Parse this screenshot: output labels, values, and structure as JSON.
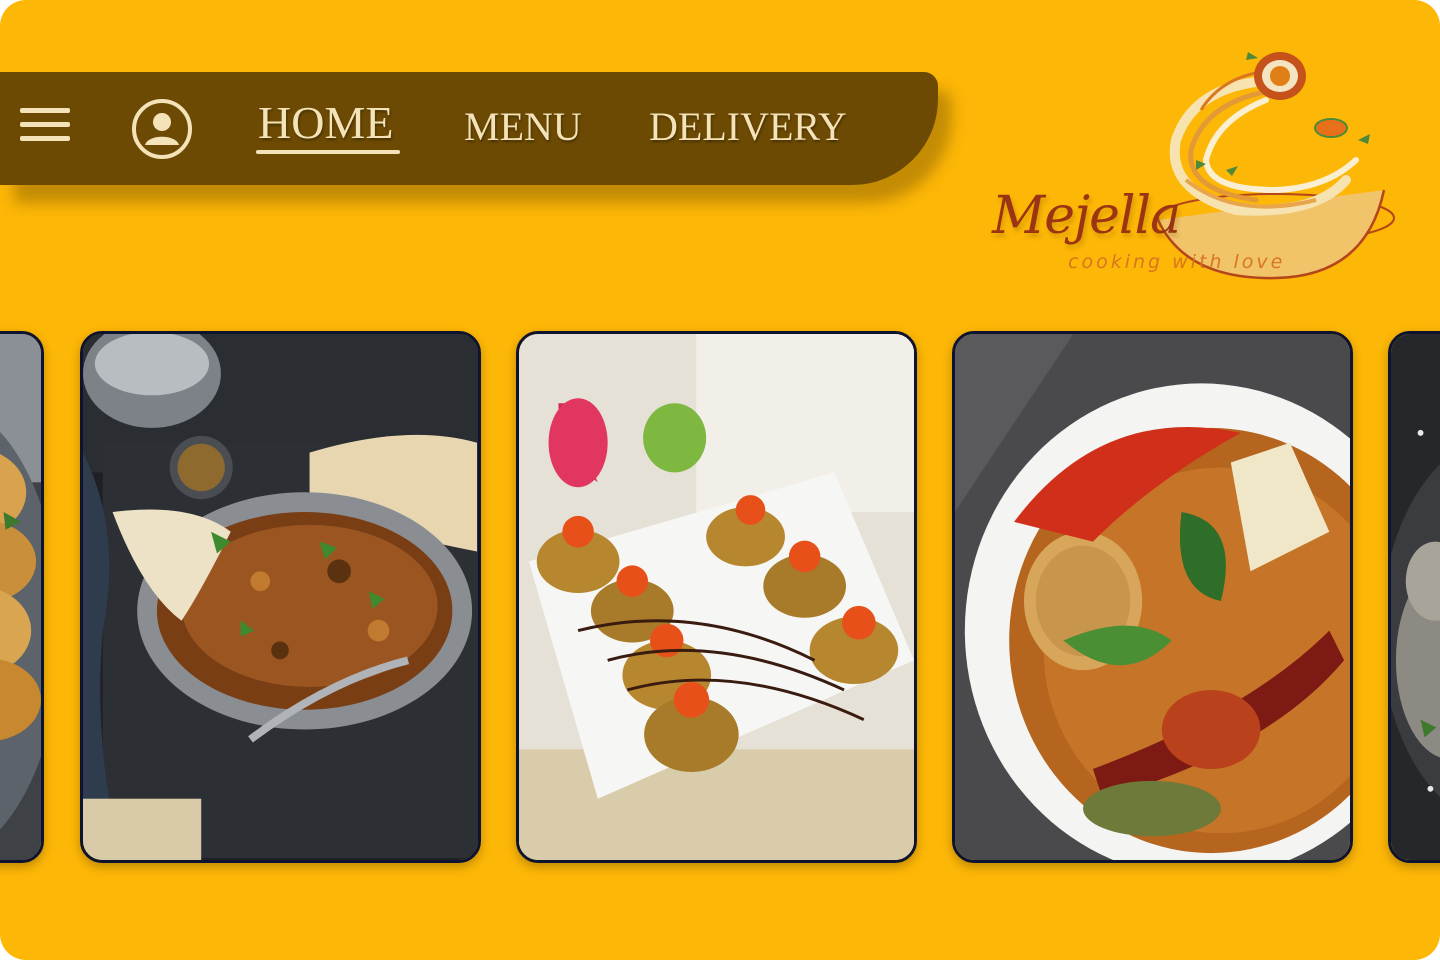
{
  "nav": {
    "menu_icon": "hamburger-menu-icon",
    "account_icon": "user-account-icon",
    "links": [
      {
        "label": "HOME",
        "active": true
      },
      {
        "label": "MENU",
        "active": false
      },
      {
        "label": "DELIVERY",
        "active": false
      }
    ]
  },
  "brand": {
    "name": "Mejella",
    "tagline": "cooking with love"
  },
  "gallery": {
    "items": [
      {
        "dish": "empanadas"
      },
      {
        "dish": "keema-curry-with-naan"
      },
      {
        "dish": "sushi-rolls"
      },
      {
        "dish": "thai-red-curry"
      },
      {
        "dish": "dark-plate-dish"
      }
    ]
  },
  "colors": {
    "background": "#FDB706",
    "navbar": "#6C4A03",
    "nav_text": "#F4E2B8",
    "brand": "#9A3412",
    "card_border": "#0E1330"
  }
}
